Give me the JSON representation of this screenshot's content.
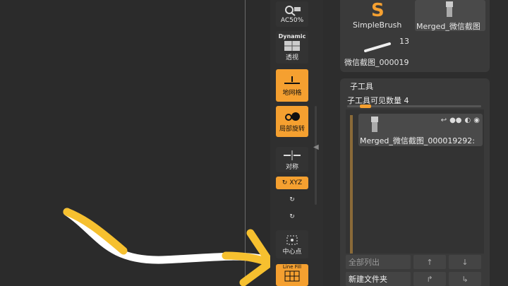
{
  "toolbar": {
    "ac50": "AC50%",
    "dynamic": "Dynamic",
    "persp": "透视",
    "floor": "地网格",
    "local": "局部旋转",
    "sym": "对称",
    "xyz": "XYZ",
    "center": "中心点",
    "lineFill": "Line Fill"
  },
  "toolbox": {
    "simplebrush": "SimpleBrush",
    "merged": "Merged_微信截图",
    "count": "13",
    "screenshot": "微信截图_000019"
  },
  "subtool": {
    "title": "子工具",
    "visible_count_label": "子工具可见数量 4",
    "item_name": "Merged_微信截图_000019292:",
    "list_all": "全部列出",
    "new_folder": "新建文件夹"
  }
}
